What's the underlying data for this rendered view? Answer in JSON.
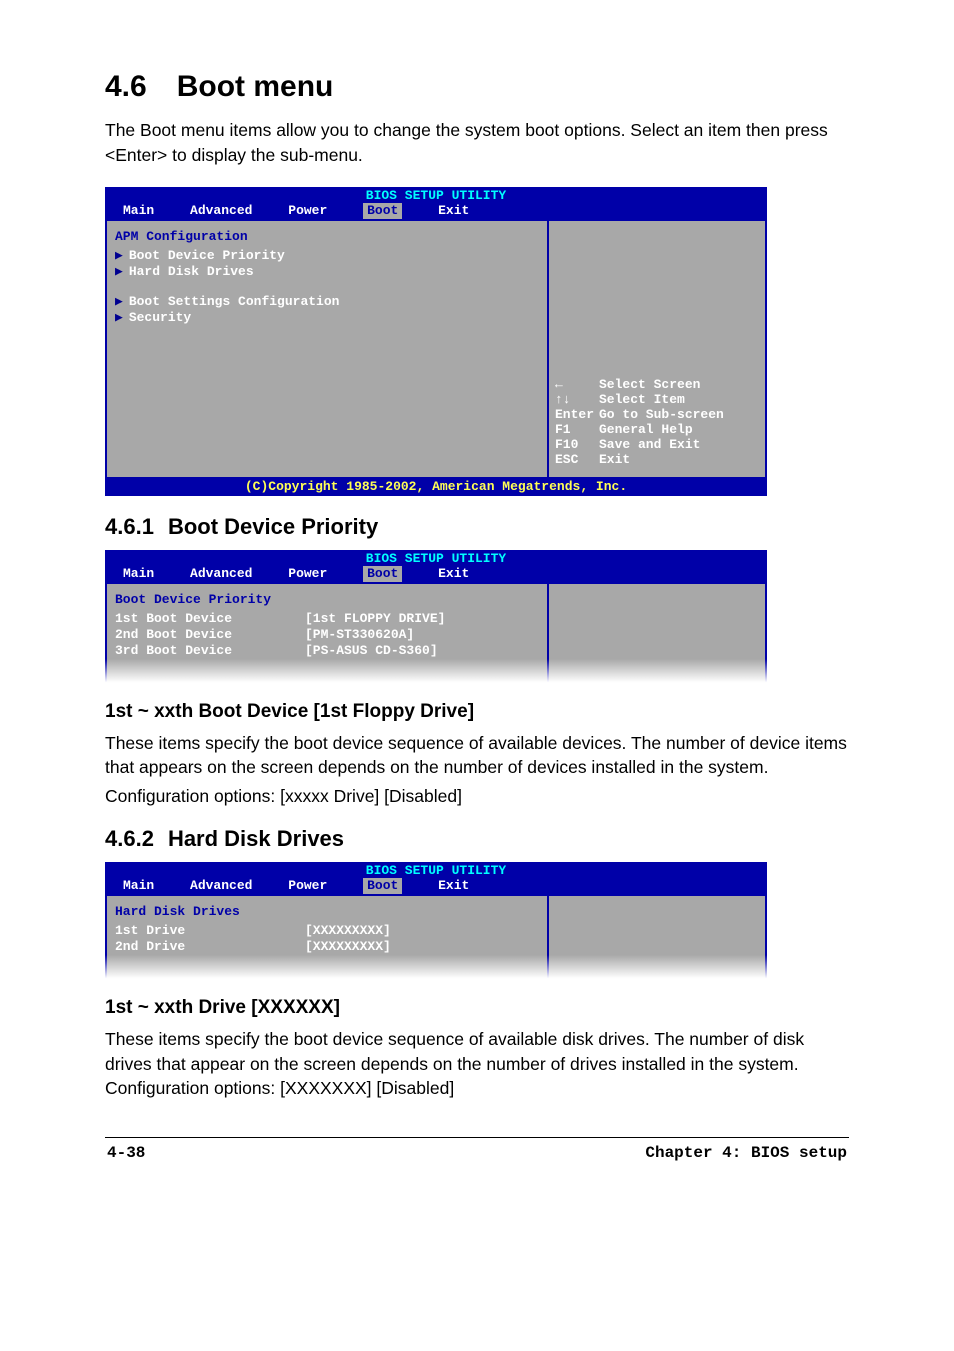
{
  "section": {
    "number": "4.6",
    "title": "Boot menu",
    "intro": "The Boot menu items allow you to change the system boot options. Select an item then press <Enter> to display the sub-menu."
  },
  "bios_common": {
    "title": "BIOS SETUP UTILITY",
    "tabs": [
      "Main",
      "Advanced",
      "Power",
      "Boot",
      "Exit"
    ],
    "selected_tab": "Boot",
    "copyright": "(C)Copyright 1985-2002, American Megatrends, Inc."
  },
  "bios1": {
    "section_head": "APM Configuration",
    "items_group1": [
      "Boot Device Priority",
      "Hard Disk Drives"
    ],
    "items_group2": [
      "Boot Settings Configuration",
      "Security"
    ],
    "help_lines": [
      {
        "key": "←",
        "text": "Select Screen"
      },
      {
        "key": "↑↓",
        "text": "Select Item"
      },
      {
        "key": "Enter",
        "text": "Go to Sub-screen"
      },
      {
        "key": "F1",
        "text": "General Help"
      },
      {
        "key": "F10",
        "text": "Save and Exit"
      },
      {
        "key": "ESC",
        "text": "Exit"
      }
    ]
  },
  "sub461": {
    "number": "4.6.1",
    "title": "Boot Device Priority"
  },
  "bios2": {
    "box_title": "Boot Device Priority",
    "rows": [
      {
        "k": "1st Boot Device",
        "v": "[1st FLOPPY DRIVE]"
      },
      {
        "k": "2nd Boot Device",
        "v": "[PM-ST330620A]"
      },
      {
        "k": "3rd Boot Device",
        "v": "[PS-ASUS CD-S360]"
      }
    ]
  },
  "opt1": {
    "heading": "1st ~ xxth Boot Device [1st Floppy Drive]",
    "para": "These items specify the boot device sequence of available devices. The number of device items that appears on the screen depends on the number of devices installed in the system.",
    "config": "Configuration options: [xxxxx Drive] [Disabled]"
  },
  "sub462": {
    "number": "4.6.2",
    "title": "Hard Disk Drives"
  },
  "bios3": {
    "box_title": "Hard Disk Drives",
    "rows": [
      {
        "k": "1st Drive",
        "v": "[XXXXXXXXX]"
      },
      {
        "k": "2nd Drive",
        "v": "[XXXXXXXXX]"
      }
    ]
  },
  "opt2": {
    "heading": "1st ~ xxth Drive [XXXXXX]",
    "para": "These items specify the boot device sequence of available disk drives. The number of disk drives that appear on the screen depends on the number of drives installed in the system. Configuration options: [XXXXXXX] [Disabled]"
  },
  "footer": {
    "page": "4-38",
    "chapter": "Chapter 4: BIOS setup"
  }
}
